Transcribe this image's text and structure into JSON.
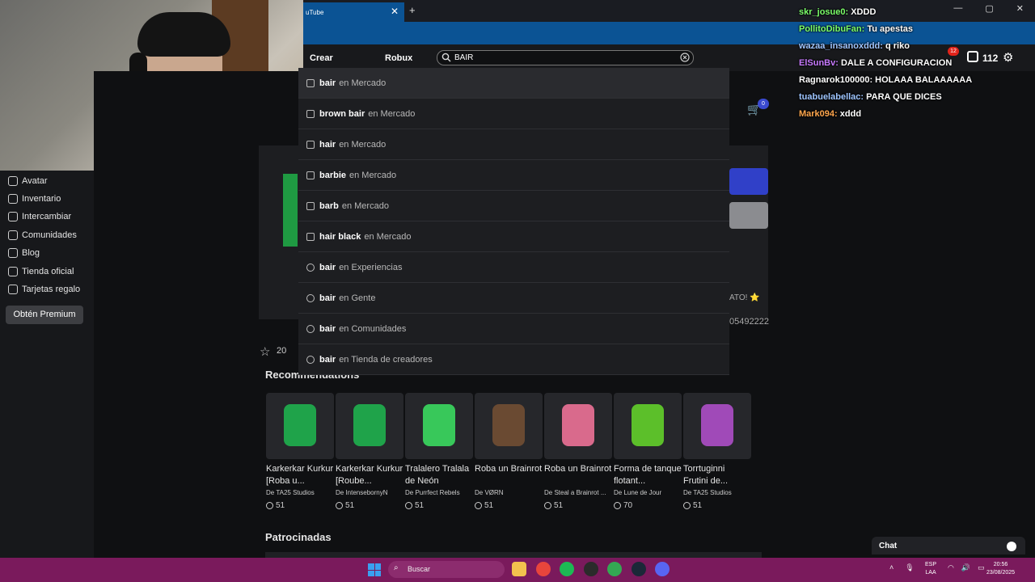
{
  "browser": {
    "tab_title": "uTube",
    "tab_close": "✕",
    "new_tab": "+",
    "window_controls": [
      "—",
      "▢",
      "✕"
    ]
  },
  "roblox_nav": {
    "create": "Crear",
    "robux": "Robux",
    "search_value": "BAIR",
    "robux_count": "112",
    "notif_count": "12"
  },
  "sidebar": {
    "items": [
      {
        "label": "Avatar",
        "icon": "avatar-icon"
      },
      {
        "label": "Inventario",
        "icon": "inventory-icon"
      },
      {
        "label": "Intercambiar",
        "icon": "trade-icon"
      },
      {
        "label": "Comunidades",
        "icon": "communities-icon"
      },
      {
        "label": "Blog",
        "icon": "blog-icon"
      },
      {
        "label": "Tienda oficial",
        "icon": "shop-icon"
      },
      {
        "label": "Tarjetas regalo",
        "icon": "gift-card-icon"
      }
    ],
    "premium_button": "Obtén Premium"
  },
  "search_suggestions": [
    {
      "term": "bair",
      "category": "en Mercado",
      "icon": "marketplace-icon"
    },
    {
      "term": "brown bair",
      "category": "en Mercado",
      "icon": "marketplace-icon"
    },
    {
      "term": "hair",
      "category": "en Mercado",
      "icon": "marketplace-icon"
    },
    {
      "term": "barbie",
      "category": "en Mercado",
      "icon": "marketplace-icon"
    },
    {
      "term": "barb",
      "category": "en Mercado",
      "icon": "marketplace-icon"
    },
    {
      "term": "hair black",
      "category": "en Mercado",
      "icon": "marketplace-icon"
    },
    {
      "term": "bair",
      "category": "en Experiencias",
      "icon": "experiences-icon"
    },
    {
      "term": "bair",
      "category": "en Gente",
      "icon": "people-icon"
    },
    {
      "term": "bair",
      "category": "en Comunidades",
      "icon": "communities-icon"
    },
    {
      "term": "bair",
      "category": "en Tienda de creadores",
      "icon": "creator-store-icon"
    }
  ],
  "item_page": {
    "favorites": "20",
    "cart_count": "0",
    "creator_tail": "ATO! ⭐",
    "id_tail": "05492222"
  },
  "recommendations": {
    "title": "Recommendations",
    "items": [
      {
        "name": "Karkerkar Kurkur [Roba u...",
        "creator": "TA25 Studios",
        "price": "51",
        "color": "#1fa34a"
      },
      {
        "name": "Karkerkar Kurkur [Roube...",
        "creator": "IntensebornyN",
        "price": "51",
        "color": "#1fa34a"
      },
      {
        "name": "Tralalero Tralala de Neón",
        "creator": "Purrfect Rebels",
        "price": "51",
        "color": "#38c85a"
      },
      {
        "name": "Roba un Brainrot",
        "creator": "VØRN",
        "price": "51",
        "color": "#6a4a32"
      },
      {
        "name": "Roba un Brainrot",
        "creator": "Steal a Brainrot ...",
        "price": "51",
        "color": "#d96a8c"
      },
      {
        "name": "Forma de tanque flotant...",
        "creator": "Lune de Jour",
        "price": "70",
        "color": "#5cbf2a"
      },
      {
        "name": "Torrtuginni Frutini de...",
        "creator": "TA25 Studios",
        "price": "51",
        "color": "#a04ab8"
      }
    ]
  },
  "sponsored": {
    "title": "Patrocinadas"
  },
  "chat_overlay": [
    {
      "user": "skr_josue0:",
      "msg": "XDDD",
      "color": "#7cff6b"
    },
    {
      "user": "PollitoDibuFan:",
      "msg": "Tu apestas",
      "color": "#7cff6b"
    },
    {
      "user": "wazaa_insanoxddd:",
      "msg": "q riko",
      "color": "#9ec5ff"
    },
    {
      "user": "ElSunBv:",
      "msg": "DALE A CONFIGURACION",
      "color": "#c87bff"
    },
    {
      "user": "Ragnarok100000:",
      "msg": "HOLAAA BALAAAAAA",
      "color": "#ffffff"
    },
    {
      "user": "tuabuelabellac:",
      "msg": "PARA QUE DICES",
      "color": "#9ec5ff"
    },
    {
      "user": "Mark094:",
      "msg": "xddd",
      "color": "#ffa64d"
    }
  ],
  "chat_widget": {
    "label": "Chat"
  },
  "taskbar": {
    "search": "Buscar",
    "lang_top": "ESP",
    "lang_bottom": "LAA",
    "time": "20:56",
    "date": "23/08/2025",
    "apps": [
      {
        "name": "file-explorer",
        "color": "#f2c14e"
      },
      {
        "name": "chrome",
        "color": "#e8453c"
      },
      {
        "name": "spotify",
        "color": "#1db954"
      },
      {
        "name": "obs",
        "color": "#2b2b2b"
      },
      {
        "name": "chrome-profile",
        "color": "#34a853"
      },
      {
        "name": "steam",
        "color": "#1b2838"
      },
      {
        "name": "discord",
        "color": "#5865f2"
      }
    ]
  }
}
